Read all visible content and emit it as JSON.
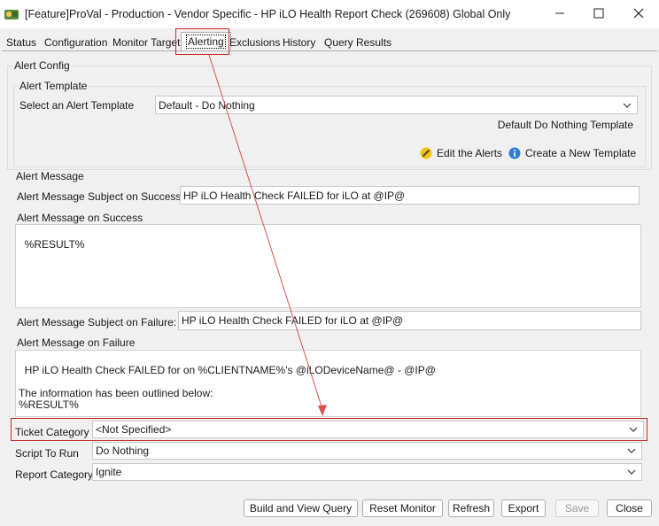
{
  "window": {
    "title": "[Feature]ProVal - Production - Vendor Specific - HP iLO Health Report Check (269608) Global Only"
  },
  "tabs": [
    {
      "label": "Status"
    },
    {
      "label": "Configuration"
    },
    {
      "label": "Monitor Target"
    },
    {
      "label": "Alerting"
    },
    {
      "label": "Exclusions"
    },
    {
      "label": "History"
    },
    {
      "label": "Query Results"
    }
  ],
  "alert_config": {
    "group_label": "Alert Config",
    "template_group_label": "Alert Template",
    "select_label": "Select an Alert Template",
    "select_value": "Default - Do Nothing",
    "template_description": "Default Do Nothing Template",
    "edit_alerts_label": "Edit the Alerts",
    "new_template_label": "Create a New Template"
  },
  "alert_message": {
    "section_label": "Alert Message",
    "subject_success_label": "Alert Message Subject on Success:",
    "subject_success_value": "HP iLO Health Check FAILED for iLO at @IP@",
    "message_success_label": "Alert Message on Success",
    "message_success_value": "%RESULT%",
    "subject_failure_label": "Alert Message Subject on Failure:",
    "subject_failure_value": "HP iLO Health Check FAILED for iLO at @IP@",
    "message_failure_label": "Alert Message on Failure",
    "message_failure_value": "HP iLO Health Check FAILED for on %CLIENTNAME%'s @iLODeviceName@ - @IP@\n\nThe information has been outlined below:\n%RESULT%"
  },
  "ticket": {
    "category_label": "Ticket Category",
    "category_value": "<Not Specified>",
    "script_label": "Script To Run",
    "script_value": "Do Nothing",
    "report_label": "Report Category",
    "report_value": "Ignite"
  },
  "buttons": {
    "build_view_query": "Build and View Query",
    "reset_monitor": "Reset Monitor",
    "refresh": "Refresh",
    "export": "Export",
    "save": "Save",
    "close": "Close"
  },
  "colors": {
    "highlight": "#c62828",
    "info_icon": "#2f7fd1"
  }
}
